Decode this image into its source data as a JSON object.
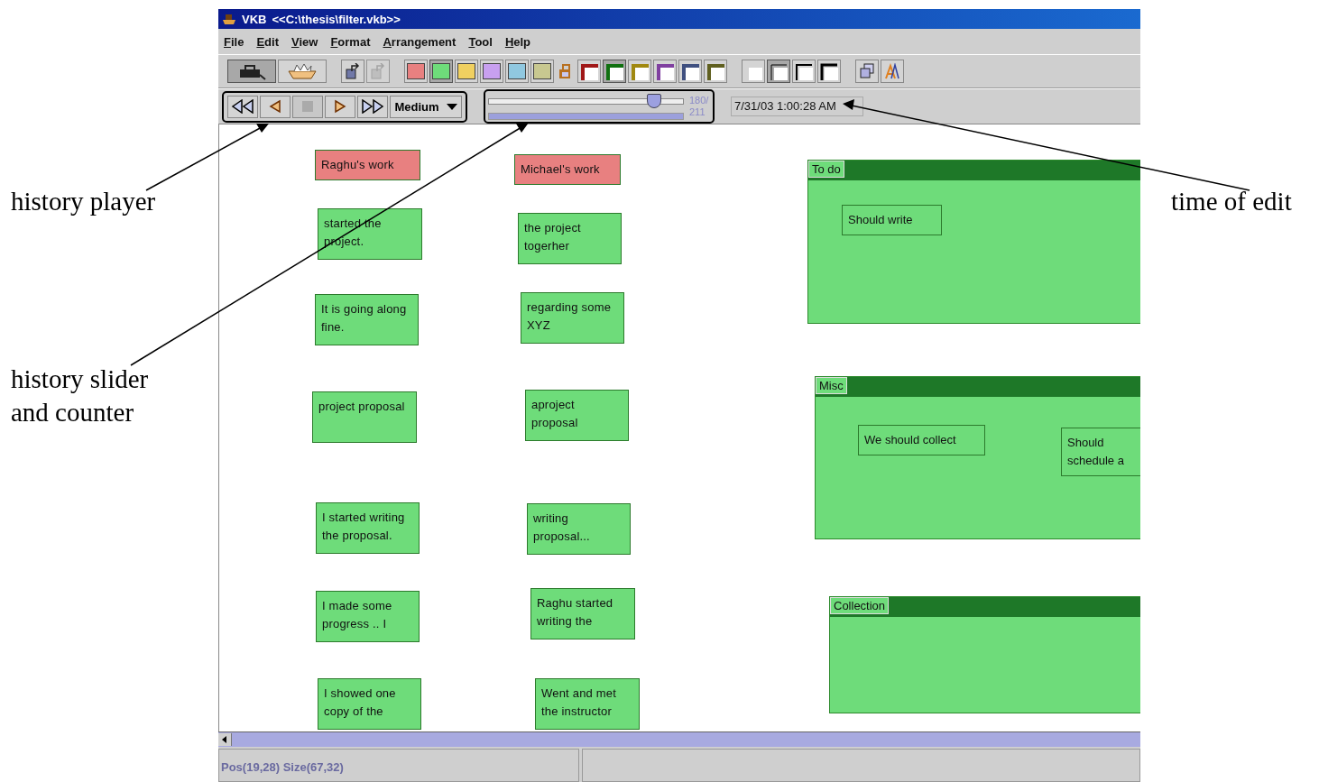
{
  "annotations": [
    {
      "text": "history player"
    },
    {
      "text": "history slider and counter"
    },
    {
      "text": "time of edit"
    }
  ],
  "window": {
    "app": "VKB",
    "title": "<<C:\\thesis\\filter.vkb>>"
  },
  "menu": [
    "File",
    "Edit",
    "View",
    "Format",
    "Arrangement",
    "Tool",
    "Help"
  ],
  "toolbar": {
    "tools": [
      {
        "selected": true
      },
      {
        "selected": false
      }
    ],
    "file_buttons": [
      {
        "disabled": false
      },
      {
        "disabled": true
      }
    ],
    "fill_colors": [
      {
        "color": "#e88080",
        "selected": false
      },
      {
        "color": "#6edc7a",
        "selected": true
      },
      {
        "color": "#f0d060",
        "selected": false
      },
      {
        "color": "#c8a0f0",
        "selected": false
      },
      {
        "color": "#90c8e0",
        "selected": false
      },
      {
        "color": "#c8c890",
        "selected": false
      }
    ],
    "border_colors": [
      {
        "color": "#a01818",
        "selected": false
      },
      {
        "color": "#107010",
        "selected": true
      },
      {
        "color": "#a08810",
        "selected": false
      },
      {
        "color": "#8040a0",
        "selected": false
      },
      {
        "color": "#405080",
        "selected": false
      },
      {
        "color": "#606020",
        "selected": false
      }
    ],
    "border_widths": [
      {
        "selected": false
      },
      {
        "selected": true
      },
      {
        "selected": false
      },
      {
        "selected": false
      }
    ]
  },
  "player": {
    "buttons": [
      {
        "kind": "rewind",
        "disabled": false
      },
      {
        "kind": "back",
        "disabled": false
      },
      {
        "kind": "stop",
        "disabled": true
      },
      {
        "kind": "play",
        "disabled": false
      },
      {
        "kind": "forward",
        "disabled": false
      }
    ],
    "speed": "Medium",
    "level": 0.85,
    "progress": {
      "level": 1
    },
    "counter": "180/",
    "total": "211",
    "time": "7/31/03 1:00:28 AM"
  },
  "canvas": {
    "notes": [
      {
        "text": "Raghu's work",
        "color": "#e88080"
      },
      {
        "text": "Michael's work",
        "color": "#e88080"
      },
      {
        "text": "started the project.",
        "color": "#6edc7a"
      },
      {
        "text": "the project togerher",
        "color": "#6edc7a"
      },
      {
        "text": "It is going along fine.",
        "color": "#6edc7a"
      },
      {
        "text": "regarding some XYZ",
        "color": "#6edc7a"
      },
      {
        "text": "project proposal",
        "color": "#6edc7a"
      },
      {
        "text": "aproject proposal",
        "color": "#6edc7a"
      },
      {
        "text": "I started writing the proposal.",
        "color": "#6edc7a"
      },
      {
        "text": "writing proposal...",
        "color": "#6edc7a"
      },
      {
        "text": "I made some progress .. I",
        "color": "#6edc7a"
      },
      {
        "text": "Raghu started writing the",
        "color": "#6edc7a"
      },
      {
        "text": "I showed one copy of the",
        "color": "#6edc7a"
      },
      {
        "text": "Went and met the instructor",
        "color": "#6edc7a"
      }
    ],
    "containers": [
      {
        "title": "To do",
        "notes": [
          {
            "text": "Should write"
          }
        ]
      },
      {
        "title": "Misc",
        "notes": [
          {
            "text": "We should collect"
          },
          {
            "text": "Should schedule a"
          }
        ]
      },
      {
        "title": "Collection"
      }
    ]
  },
  "status_bar": "Pos(19,28) Size(67,32)"
}
